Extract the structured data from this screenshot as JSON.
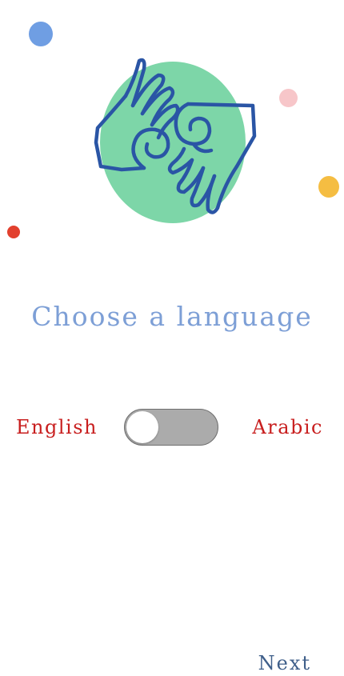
{
  "title": "Choose a language",
  "language_toggle": {
    "left_label": "English",
    "right_label": "Arabic",
    "state": "off"
  },
  "next_label": "Next",
  "hero": {
    "icon": "sign-language-hands-icon",
    "circle_color": "#7dd6a8",
    "stroke_color": "#2a55a5"
  },
  "colors": {
    "title": "#7d9fd6",
    "language_label": "#c81e1e",
    "next": "#3f5f8a",
    "toggle_track": "#ababab",
    "dot_blue": "#6f9ee3",
    "dot_pink": "#f7c6c9",
    "dot_yellow": "#f5bd42",
    "dot_red": "#e2402e"
  }
}
